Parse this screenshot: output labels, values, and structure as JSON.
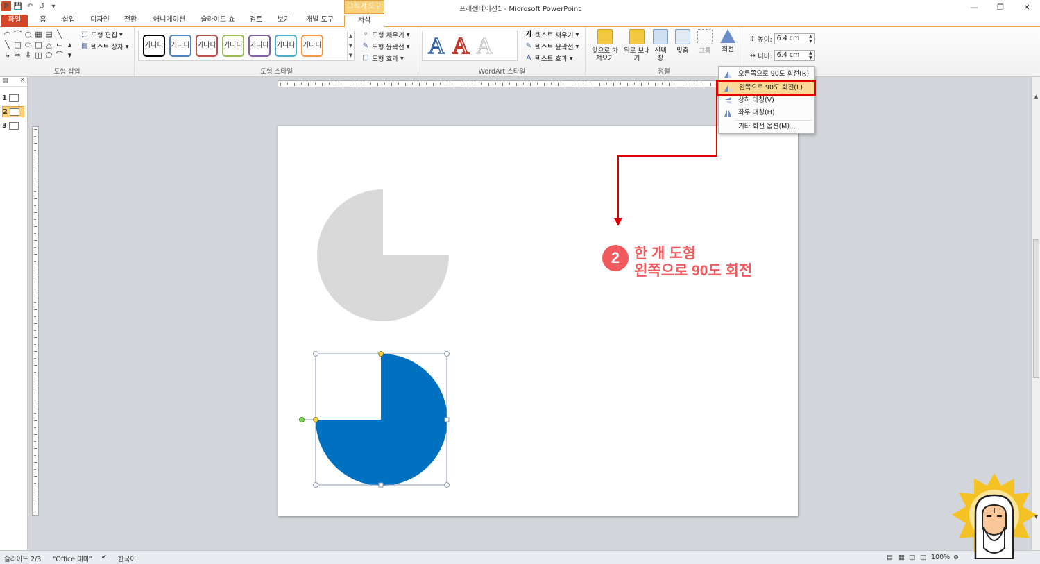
{
  "window": {
    "title": "프레젠테이션1 - Microsoft PowerPoint",
    "ctx_group": "그리기 도구"
  },
  "tabs": [
    "파일",
    "홈",
    "삽입",
    "디자인",
    "전환",
    "애니메이션",
    "슬라이드 쇼",
    "검토",
    "보기",
    "개발 도구",
    "서식"
  ],
  "active_tab": "서식",
  "ribbon": {
    "insert_shapes": {
      "label": "도형 삽입",
      "edit_shape": "도형 편집",
      "text_box": "텍스트 상자"
    },
    "shape_styles": {
      "label": "도형 스타일",
      "swatch_text": "가나다",
      "swatch_colors": [
        "#000000",
        "#4f81bd",
        "#c0504d",
        "#9bbb59",
        "#8064a2",
        "#4bacc6",
        "#f79646"
      ],
      "fill": "도형 채우기",
      "outline": "도형 윤곽선",
      "effects": "도형 효과"
    },
    "wordart": {
      "label": "WordArt 스타일",
      "text_fill": "텍스트 채우기",
      "text_outline": "텍스트 윤곽선",
      "text_effects": "텍스트 효과"
    },
    "arrange": {
      "label": "정렬",
      "bring_forward": "앞으로 가져오기",
      "send_backward": "뒤로 보내기",
      "selection": "선택 창",
      "align": "맞춤",
      "group": "그룹",
      "rotate": "회전"
    },
    "size": {
      "height_label": "높이:",
      "height_value": "6.4 cm",
      "width_label": "너비:",
      "width_value": "6.4 cm"
    }
  },
  "rotate_menu": [
    {
      "label": "오른쪽으로 90도 회전(R)",
      "highlighted": false
    },
    {
      "label": "왼쪽으로 90도 회전(L)",
      "highlighted": true
    },
    {
      "label": "상하 대칭(V)",
      "highlighted": false
    },
    {
      "label": "좌우 대칭(H)",
      "highlighted": false
    },
    {
      "label": "기타 회전 옵션(M)...",
      "highlighted": false
    }
  ],
  "slides": [
    1,
    2,
    3
  ],
  "selected_slide": 2,
  "annotation": {
    "number": "2",
    "line1": "한 개 도형",
    "line2": "왼쪽으로 90도 회전"
  },
  "colors": {
    "accent_red": "#f0595d",
    "shape_blue": "#0070c0",
    "shape_gray": "#d9d9d9",
    "highlight": "#e00000"
  },
  "status": {
    "slide": "슬라이드 2/3",
    "theme": "\"Office 테마\"",
    "language": "한국어",
    "zoom": "100%"
  }
}
